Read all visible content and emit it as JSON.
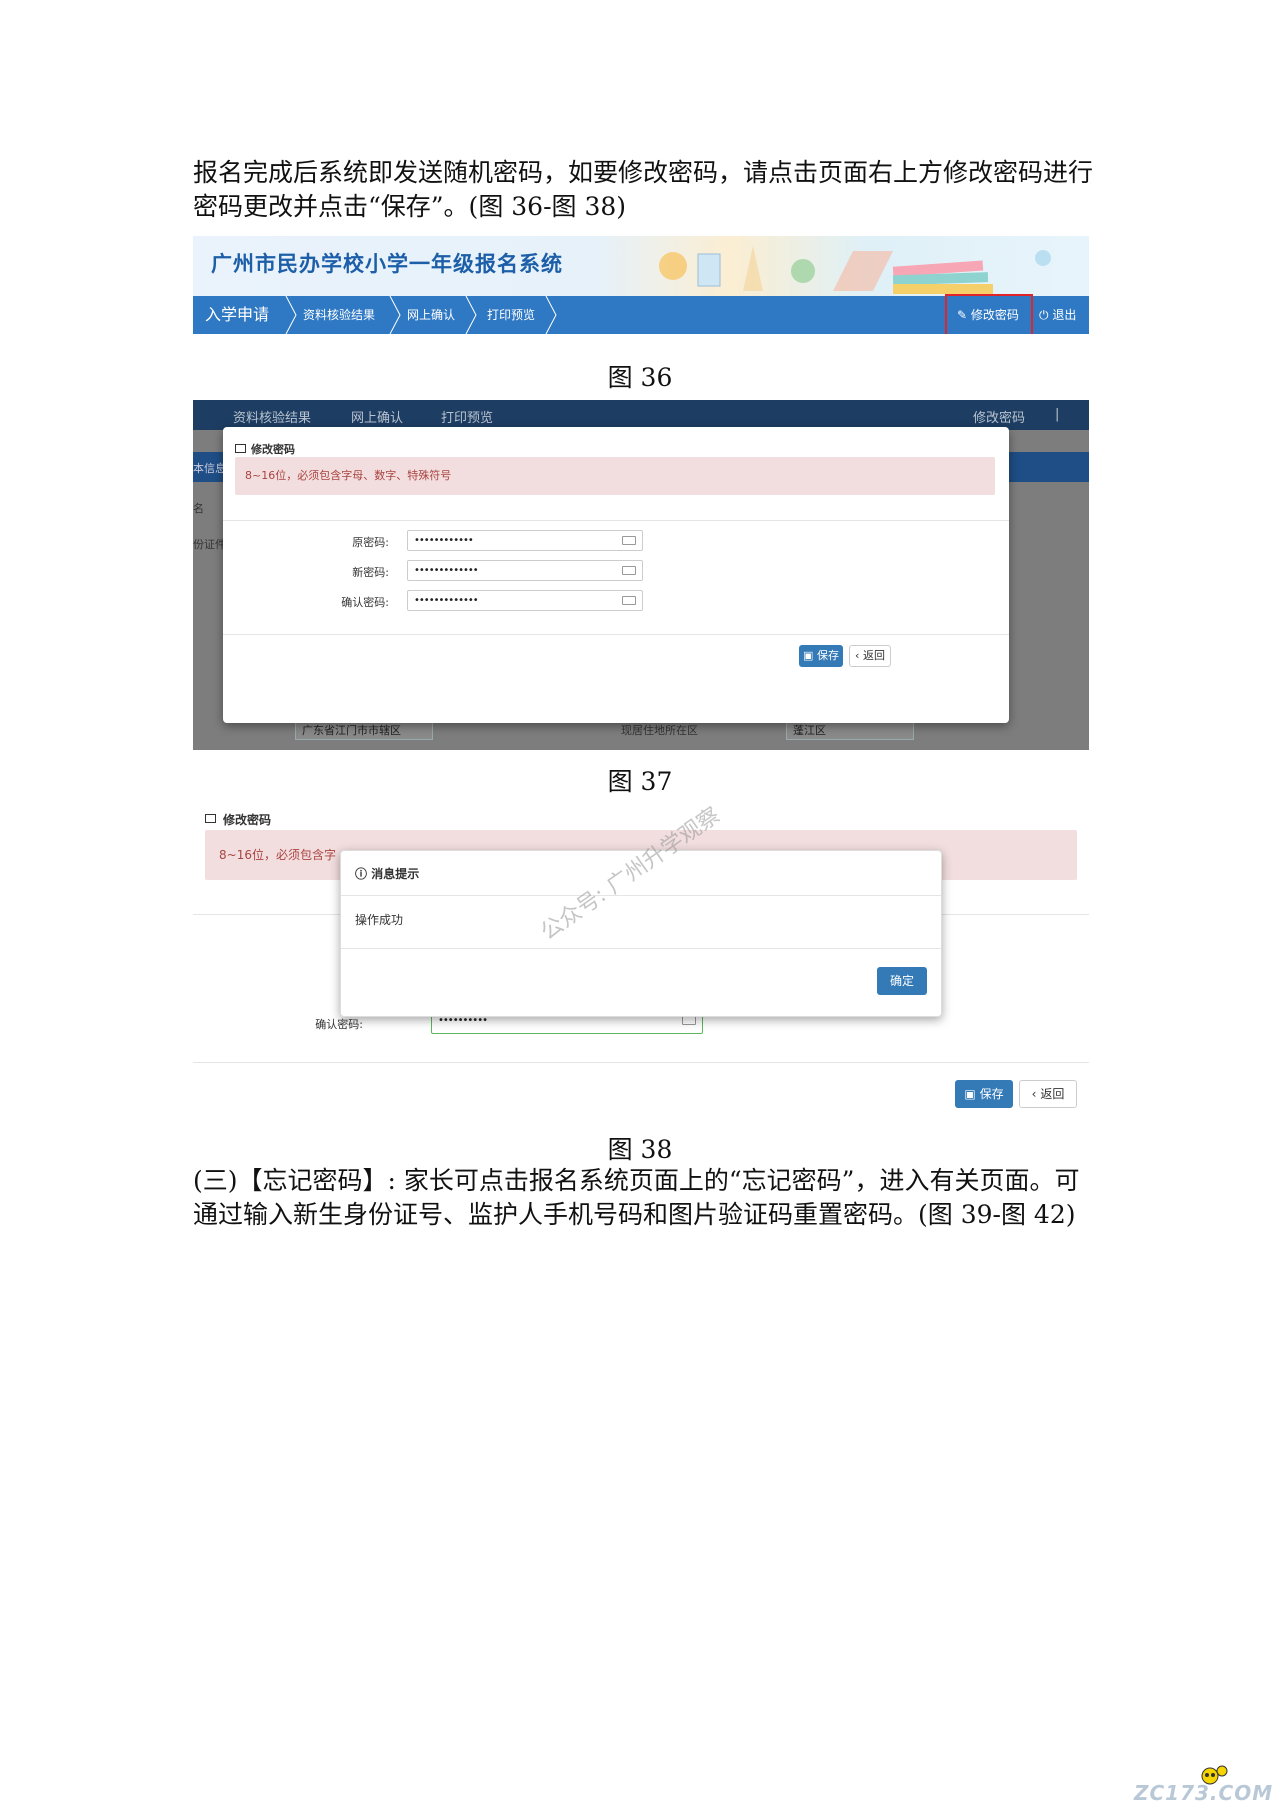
{
  "paragraph_1": "报名完成后系统即发送随机密码，如要修改密码，请点击页面右上方修改密码进行密码更改并点击“保存”。(图 36-图 38)",
  "fig36": {
    "banner_title": "广州市民办学校小学一年级报名系统",
    "nav": {
      "main": "入学申请",
      "items": [
        "资料核验结果",
        "网上确认",
        "打印预览"
      ],
      "change_password": "修改密码",
      "logout": "退出"
    },
    "caption": "图 36"
  },
  "fig37": {
    "bg_nav": [
      "资料核验结果",
      "网上确认",
      "打印预览"
    ],
    "bg_right": [
      "修改密码",
      "|"
    ],
    "bg_left_fragments": [
      "本信息",
      "名",
      "份证件"
    ],
    "bg_field_1": "广东省江门市市辖区",
    "bg_text_2": "现居住地所在区",
    "bg_field_2": "蓬江区",
    "modal": {
      "title": "修改密码",
      "hint": "8~16位，必须包含字母、数字、特殊符号",
      "fields": [
        {
          "label": "原密码:",
          "value": "••••••••••••"
        },
        {
          "label": "新密码:",
          "value": "•••••••••••••"
        },
        {
          "label": "确认密码:",
          "value": "•••••••••••••"
        }
      ],
      "save": "保存",
      "back": "返回"
    },
    "caption": "图 37"
  },
  "fig38": {
    "title": "修改密码",
    "hint_partial": "8~16位，必须包含字",
    "confirm_label": "确认密码:",
    "confirm_value": "••••••••••",
    "msgbox": {
      "title": "消息提示",
      "body": "操作成功",
      "ok": "确定"
    },
    "watermark": "公众号: 广州升学观察",
    "save": "保存",
    "back": "返回",
    "caption": "图 38"
  },
  "paragraph_2": "(三)【忘记密码】: 家长可点击报名系统页面上的“忘记密码”，进入有关页面。可通过输入新生身份证号、监护人手机号码和图片验证码重置密码。(图 39-图 42)",
  "logo_text": "ZC173.COM",
  "colors": {
    "nav_blue": "#2f79c4",
    "alert_bg": "#f2dede",
    "alert_text": "#a94442",
    "primary": "#337ab7",
    "highlight_red": "#e0252a"
  }
}
